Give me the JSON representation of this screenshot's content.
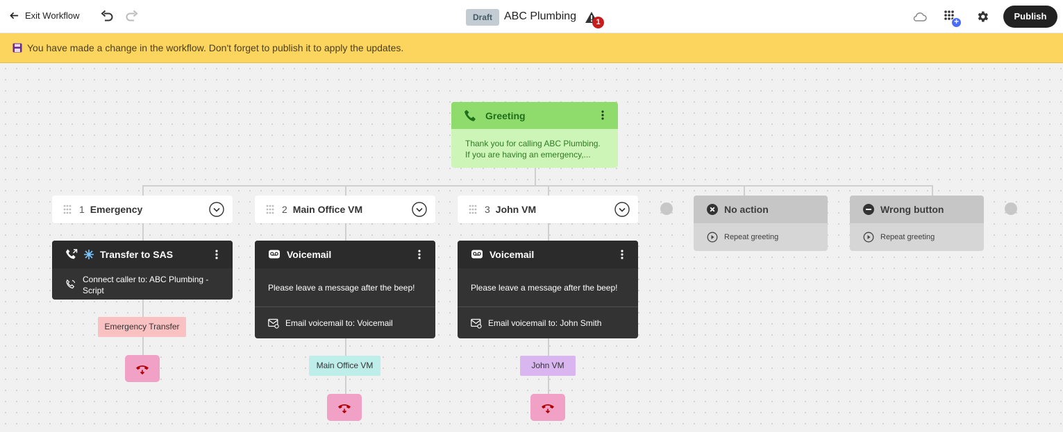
{
  "topbar": {
    "exit_label": "Exit Workflow",
    "status_badge": "Draft",
    "title": "ABC Plumbing",
    "alert_count": "1",
    "apps_badge": "+",
    "publish_label": "Publish"
  },
  "banner": {
    "message": "You have made a change in the workflow. Don't forget to publish it to apply the updates."
  },
  "greeting": {
    "title": "Greeting",
    "line1": "Thank you for calling ABC Plumbing.",
    "line2": "If you are having an emergency,..."
  },
  "options": [
    {
      "number": "1",
      "name": "Emergency"
    },
    {
      "number": "2",
      "name": "Main Office VM"
    },
    {
      "number": "3",
      "name": "John VM"
    }
  ],
  "no_action": {
    "title": "No action",
    "action": "Repeat greeting"
  },
  "wrong_button": {
    "title": "Wrong button",
    "action": "Repeat greeting"
  },
  "transfer_card": {
    "title": "Transfer to SAS",
    "line1": "Connect caller to: ABC Plumbing -",
    "line2": "Script",
    "tag": "Emergency Transfer"
  },
  "voicemail_main": {
    "title": "Voicemail",
    "message": "Please leave a message after the beep!",
    "email": "Email voicemail to: Voicemail",
    "tag": "Main Office VM"
  },
  "voicemail_john": {
    "title": "Voicemail",
    "message": "Please leave a message after the beep!",
    "email": "Email voicemail to: John Smith",
    "tag": "John VM"
  },
  "colors": {
    "banner": "#fcd55f",
    "greeting_header": "#8fdc6c",
    "greeting_body": "#cdf5b8",
    "tag_emergency": "#f9c1c1",
    "tag_main_office": "#bdeeea",
    "tag_john": "#d9b6f0",
    "hangup": "#f1a0c6",
    "hangup_icon": "#b00000"
  },
  "icons": [
    "arrow-left-icon",
    "undo-icon",
    "redo-icon",
    "alert-icon",
    "cloud-icon",
    "apps-icon",
    "gear-icon",
    "save-icon",
    "phone-icon",
    "kebab-icon",
    "grip-icon",
    "chevron-down-icon",
    "x-circle-icon",
    "minus-circle-icon",
    "repeat-icon",
    "phone-transfer-icon",
    "snowflake-icon",
    "phone-connect-icon",
    "voicemail-icon",
    "email-icon",
    "hangup-icon"
  ]
}
